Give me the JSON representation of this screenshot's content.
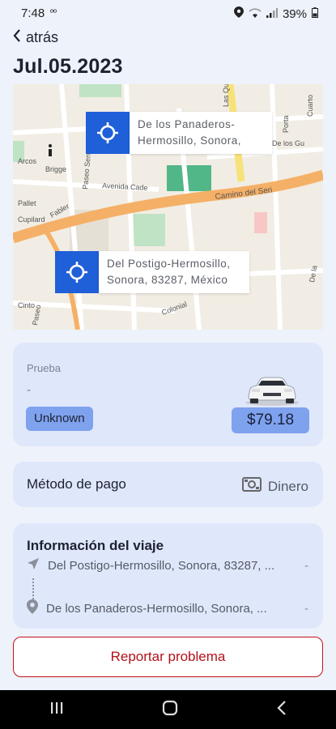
{
  "status": {
    "time": "7:48",
    "extra": "ºº",
    "battery": "39%"
  },
  "header": {
    "back_label": "atrás",
    "date": "Jul.05.2023"
  },
  "map": {
    "streets": [
      "Avenida Cade",
      "Camino del Seri",
      "Colonial",
      "Brigge",
      "Paseo Sensoc",
      "Fabler",
      "Cupilard",
      "Pallet",
      "Arcos",
      "Paseo",
      "Cinto",
      "De los Gu",
      "Porta",
      "Cuarto",
      "Las Qui",
      "De la"
    ],
    "origin_label": "Del Postigo-Hermosillo, Sonora, 83287, México",
    "origin_lines": [
      "Del Postigo-Hermosillo,",
      "Sonora, 83287, México"
    ],
    "destination_lines": [
      "De los Panaderos-",
      "Hermosillo, Sonora,"
    ]
  },
  "trip": {
    "category": "Prueba",
    "dash": "-",
    "status_badge": "Unknown",
    "price": "$79.18"
  },
  "payment": {
    "label": "Método de pago",
    "value": "Dinero"
  },
  "info": {
    "title": "Información del viaje",
    "rows": [
      {
        "text": "Del Postigo-Hermosillo, Sonora, 83287, ...",
        "end": "-"
      },
      {
        "text": "De los Panaderos-Hermosillo, Sonora, ...",
        "end": "-"
      }
    ]
  },
  "actions": {
    "report": "Reportar problema"
  },
  "colors": {
    "accent": "#1f5fd8",
    "card": "#dfe7fb",
    "badge": "#7fa2ee",
    "danger": "#b3121a"
  }
}
